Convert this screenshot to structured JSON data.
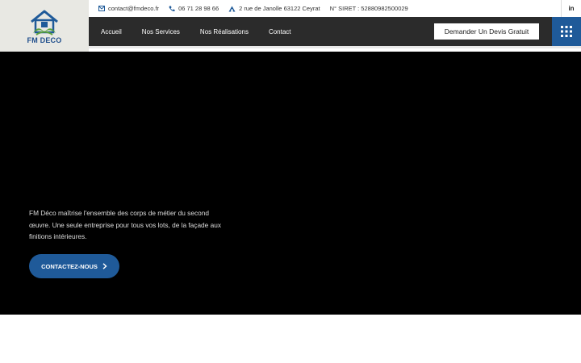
{
  "logo": {
    "text": "FM DECO",
    "icon": "house-leaf-logo"
  },
  "topbar": {
    "email": "contact@fmdeco.fr",
    "phone": "06 71 28 98 66",
    "address": "2 rue de Janolle 63122 Ceyrat",
    "siret": "N° SIRET : 52880982500029",
    "social": "in"
  },
  "nav": {
    "items": [
      "Accueil",
      "Nos Services",
      "Nos Réalisations",
      "Contact"
    ],
    "quote_label": "Demander Un Devis Gratuit",
    "menu_icon": "grid-menu-icon"
  },
  "hero": {
    "description": "FM Déco maîtrise l'ensemble des corps de métier du second œuvre. Une seule entreprise pour tous vos lots, de la façade aux finitions intérieures.",
    "cta_label": "CONTACTEZ-NOUS"
  },
  "colors": {
    "brand_blue": "#1f5a99",
    "nav_bg": "#2b2b2b",
    "logo_bg": "#e8e8e3"
  }
}
